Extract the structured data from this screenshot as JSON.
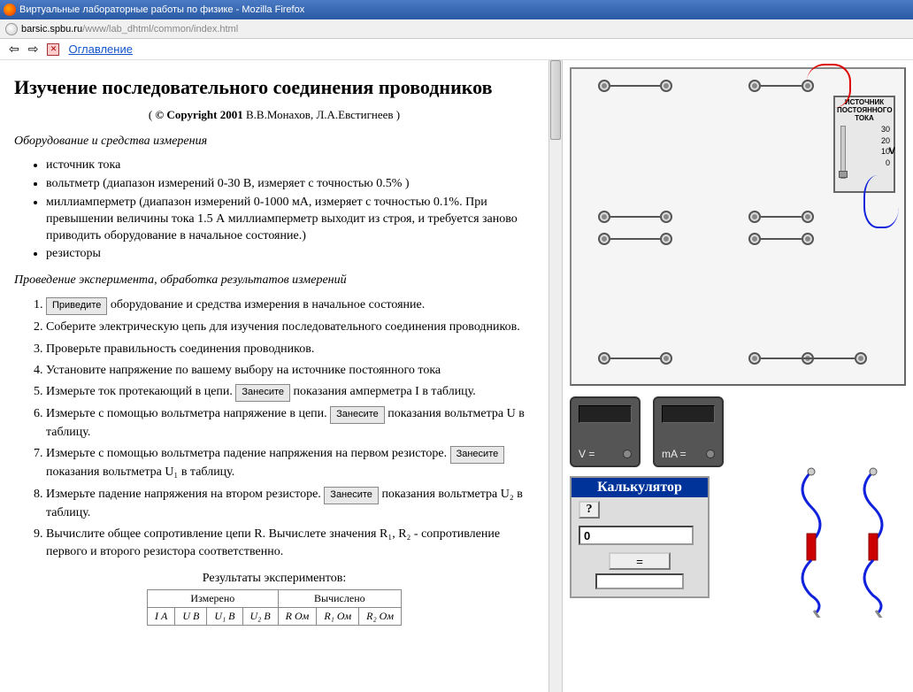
{
  "window": {
    "title": "Виртуальные лабораторные работы по физике - Mozilla Firefox"
  },
  "address": {
    "host": "barsic.spbu.ru",
    "path": "/www/lab_dhtml/common/index.html"
  },
  "nav": {
    "back": "⇦",
    "fwd": "⇨",
    "toc": "Оглавление"
  },
  "page": {
    "title": "Изучение последовательного соединения проводников",
    "copyright_bold": "© Copyright 2001",
    "copyright_rest": " В.В.Монахов, Л.А.Евстигнеев )",
    "equip_head": "Оборудование и средства измерения",
    "equip": [
      "источник тока",
      "вольтметр (диапазон измерений 0-30 В, измеряет с точностью 0.5% )",
      "миллиамперметр (диапазон измерений 0-1000 мА, измеряет с точностью 0.1%. При превышении величины тока 1.5 А миллиамперметр выходит из строя, и требуется заново приводить оборудование в начальное состояние.)",
      "резисторы"
    ],
    "proc_head": "Проведение эксперимента, обработка результатов измерений",
    "btn_reset": "Приведите",
    "btn_save": "Занесите",
    "step1_after": " оборудование и средства измерения в начальное состояние.",
    "step2": "Соберите электрическую цепь для изучения последовательного соединения проводников.",
    "step3": "Проверьте правильность соединения проводников.",
    "step4": "Установите напряжение по вашему выбору на источнике постоянного тока",
    "step5a": "Измерьте ток протекающий в цепи. ",
    "step5b": " показания амперметра I в таблицу.",
    "step6a": "Измерьте с помощью вольтметра напряжение в цепи. ",
    "step6b": " показания вольтметра U в таблицу.",
    "step7a": "Измерьте с помощью вольтметра падение напряжения на первом резисторе. ",
    "step7b": " показания вольтметра U₁ в таблицу.",
    "step8a": "Измерьте падение напряжения на втором резисторе. ",
    "step8b": " показания вольтметра U₂ в таблицу.",
    "step9": "Вычислите общее сопротивление цепи R. Вычислете значения R₁, R₂ - сопротивление первого и второго резистора соответственно.",
    "results_title": "Результаты экспериментов:",
    "tbl": {
      "measured": "Измерено",
      "computed": "Вычислено",
      "c1": "I А",
      "c2": "U В",
      "c3": "U₁ В",
      "c4": "U₂ В",
      "c5": "R Ом",
      "c6": "R₁ Ом",
      "c7": "R₂ Ом"
    }
  },
  "psu": {
    "label": "ИСТОЧНИК ПОСТОЯННОГО ТОКА",
    "t30": "30",
    "t20": "20",
    "t10": "10",
    "t0": "0",
    "unit": "V"
  },
  "meter1": {
    "label": "V ="
  },
  "meter2": {
    "label": "mA ="
  },
  "calc": {
    "title": "Калькулятор",
    "help": "?",
    "input": "0",
    "eq": "="
  }
}
